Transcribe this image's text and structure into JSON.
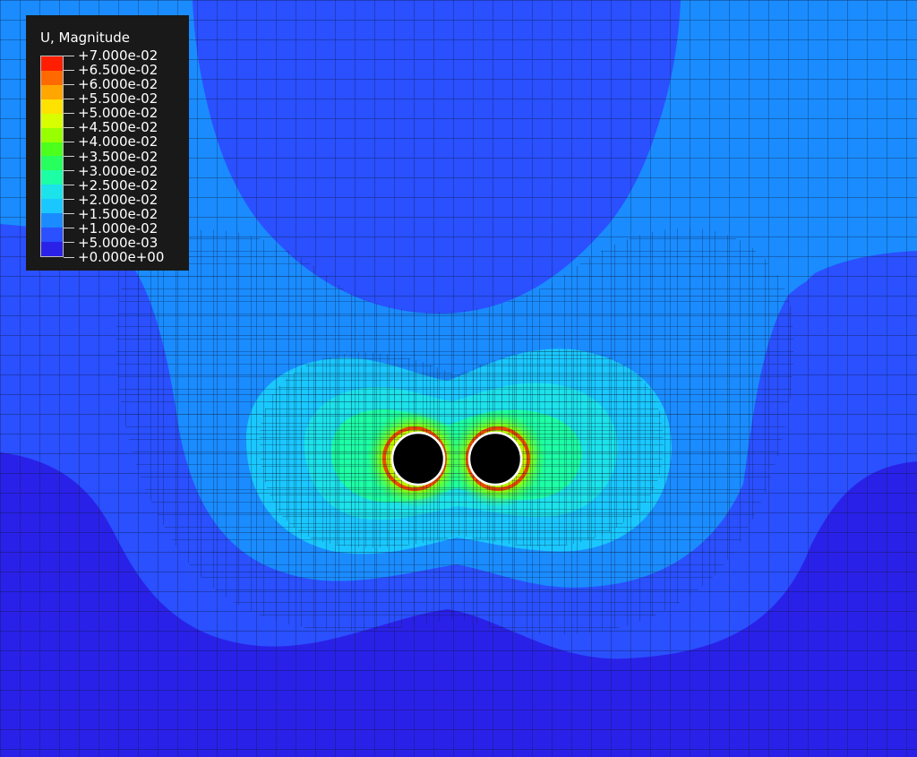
{
  "legend": {
    "title": "U, Magnitude",
    "ticks": [
      "+7.000e-02",
      "+6.500e-02",
      "+6.000e-02",
      "+5.500e-02",
      "+5.000e-02",
      "+4.500e-02",
      "+4.000e-02",
      "+3.500e-02",
      "+3.000e-02",
      "+2.500e-02",
      "+2.000e-02",
      "+1.500e-02",
      "+1.000e-02",
      "+5.000e-03",
      "+0.000e+00"
    ],
    "colors": [
      "#ff1e00",
      "#ff6a00",
      "#ffa600",
      "#ffe200",
      "#d8ff00",
      "#98ff00",
      "#4dff1c",
      "#27ff5e",
      "#1cffa4",
      "#1ce2ea",
      "#1ac8ff",
      "#1a8cff",
      "#2a50ff",
      "#2a21e8"
    ]
  },
  "colors": {
    "mesh_line": "#0c1430",
    "hole": "#000000",
    "hole_rim": "#ffffff",
    "panel": "#191919"
  },
  "icons": {
    "holes": "twin-circular-tunnel-openings"
  }
}
